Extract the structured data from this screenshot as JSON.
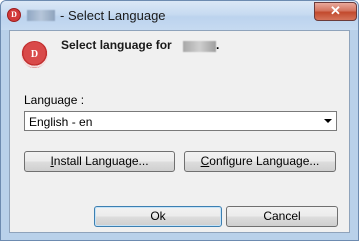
{
  "window": {
    "title": "- Select Language",
    "app_icon_letter": "D"
  },
  "dialog": {
    "heading": "Select language for",
    "heading_suffix": ".",
    "language_label": "Language :",
    "language_select": {
      "selected": "English - en"
    },
    "buttons": {
      "install_accel": "I",
      "install_rest": "nstall Language...",
      "configure_accel": "C",
      "configure_rest": "onfigure Language...",
      "ok": "Ok",
      "cancel": "Cancel"
    }
  },
  "colors": {
    "accent": "#d23a3a",
    "close_button": "#c24a2d",
    "dialog_bg": "#f0f0f0"
  },
  "icons": [
    "app-icon",
    "close-icon",
    "dropdown-arrow-icon"
  ]
}
